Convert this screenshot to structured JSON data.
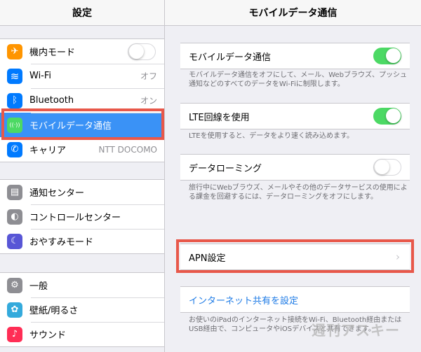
{
  "left": {
    "title": "設定",
    "group1": [
      {
        "label": "機内モード",
        "icon": "airplane-icon",
        "color": "#ff9500",
        "glyph": "✈",
        "toggle": "off"
      },
      {
        "label": "Wi-Fi",
        "icon": "wifi-icon",
        "color": "#007aff",
        "glyph": "≋",
        "value": "オフ"
      },
      {
        "label": "Bluetooth",
        "icon": "bluetooth-icon",
        "color": "#007aff",
        "glyph": "ᛒ",
        "value": "オン"
      },
      {
        "label": "モバイルデータ通信",
        "icon": "antenna-icon",
        "color": "#4cd964",
        "glyph": "((·))",
        "selected": true
      },
      {
        "label": "キャリア",
        "icon": "phone-icon",
        "color": "#007aff",
        "glyph": "✆",
        "value": "NTT DOCOMO"
      }
    ],
    "group2": [
      {
        "label": "通知センター",
        "icon": "notification-center-icon",
        "color": "#8e8e93",
        "glyph": "▤"
      },
      {
        "label": "コントロールセンター",
        "icon": "control-center-icon",
        "color": "#8e8e93",
        "glyph": "◐"
      },
      {
        "label": "おやすみモード",
        "icon": "moon-icon",
        "color": "#5856d6",
        "glyph": "☾"
      }
    ],
    "group3": [
      {
        "label": "一般",
        "icon": "gear-icon",
        "color": "#8e8e93",
        "glyph": "⚙"
      },
      {
        "label": "壁紙/明るさ",
        "icon": "wallpaper-icon",
        "color": "#34aadc",
        "glyph": "✿"
      },
      {
        "label": "サウンド",
        "icon": "speaker-icon",
        "color": "#ff2d55",
        "glyph": "♪"
      }
    ]
  },
  "right": {
    "title": "モバイルデータ通信",
    "mobile_data": {
      "label": "モバイルデータ通信",
      "toggle": "on",
      "note": "モバイルデータ通信をオフにして、メール、Webブラウズ、プッシュ通知などのすべてのデータをWi-Fiに制限します。"
    },
    "lte": {
      "label": "LTE回線を使用",
      "toggle": "on",
      "note": "LTEを使用すると、データをより速く読み込めます。"
    },
    "roaming": {
      "label": "データローミング",
      "toggle": "off",
      "note": "旅行中にWebブラウズ、メールやその他のデータサービスの使用による課金を回避するには、データローミングをオフにします。"
    },
    "apn": {
      "label": "APN設定"
    },
    "hotspot": {
      "label": "インターネット共有を設定",
      "note": "お使いのiPadのインターネット接続をWi-Fi、Bluetooth経由またはUSB経由で、コンピュータやiOSデバイスと共有できます。"
    }
  },
  "watermark": "週刊アスキー",
  "colors": {
    "highlight": "#e8584a",
    "selected": "#3a92f6",
    "toggle_on": "#4cd964"
  }
}
